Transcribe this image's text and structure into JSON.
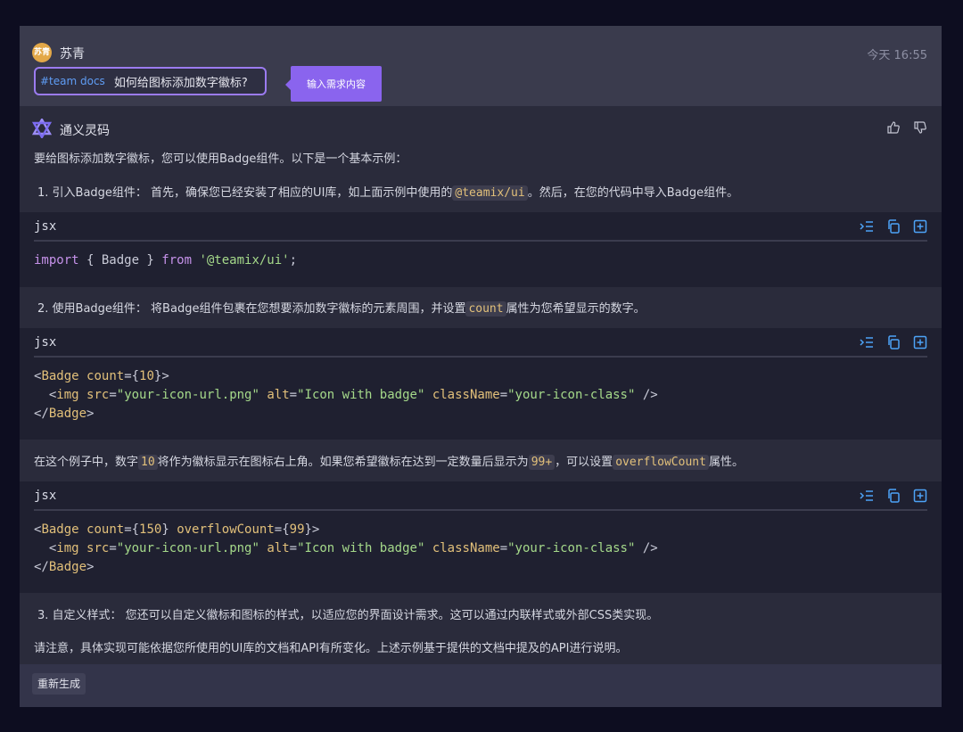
{
  "user": {
    "avatar_text": "苏青",
    "name": "苏青",
    "timestamp": "今天 16:55"
  },
  "query": {
    "tag": "#team docs",
    "text": "如何给图标添加数字徽标?"
  },
  "hint": {
    "text": "输入需求内容"
  },
  "assistant": {
    "name": "通义灵码",
    "icons": [
      "thumbs-up-icon",
      "thumbs-down-icon"
    ]
  },
  "content": {
    "intro": "要给图标添加数字徽标，您可以使用Badge组件。以下是一个基本示例：",
    "step1": {
      "prefix": "1. 引入Badge组件： 首先，确保您已经安装了相应的UI库，如上面示例中使用的",
      "code": "@teamix/ui",
      "suffix": "。然后，在您的代码中导入Badge组件。"
    },
    "step2": {
      "prefix": "2. 使用Badge组件： 将Badge组件包裹在您想要添加数字徽标的元素周围，并设置",
      "code": "count",
      "suffix": "属性为您希望显示的数字。"
    },
    "para": {
      "p1": "在这个例子中，数字",
      "c1": "10",
      "p2": "将作为徽标显示在图标右上角。如果您希望徽标在达到一定数量后显示为",
      "c2": "99+",
      "p3": "，可以设置",
      "c3": "overflowCount",
      "p4": "属性。"
    },
    "step3": "3. 自定义样式： 您还可以自定义徽标和图标的样式，以适应您的界面设计需求。这可以通过内联样式或外部CSS类实现。",
    "note": "请注意，具体实现可能依据您所使用的UI库的文档和API有所变化。上述示例基于提供的文档中提及的API进行说明。"
  },
  "code_blocks": [
    {
      "lang": "jsx",
      "lines": [
        "import { Badge } from '@teamix/ui';"
      ]
    },
    {
      "lang": "jsx",
      "lines": [
        "<Badge count={10}>",
        "  <img src=\"your-icon-url.png\" alt=\"Icon with badge\" className=\"your-icon-class\" />",
        "</Badge>"
      ]
    },
    {
      "lang": "jsx",
      "lines": [
        "<Badge count={150} overflowCount={99}>",
        "  <img src=\"your-icon-url.png\" alt=\"Icon with badge\" className=\"your-icon-class\" />",
        "</Badge>"
      ]
    }
  ],
  "code_actions": [
    "insert-icon",
    "copy-icon",
    "new-file-icon"
  ],
  "footer": {
    "regenerate_label": "重新生成"
  },
  "colors": {
    "accent": "#8a64ee",
    "link": "#5f9df5",
    "code_bg": "#1f2030",
    "panel_bg": "#2a2b3b"
  }
}
